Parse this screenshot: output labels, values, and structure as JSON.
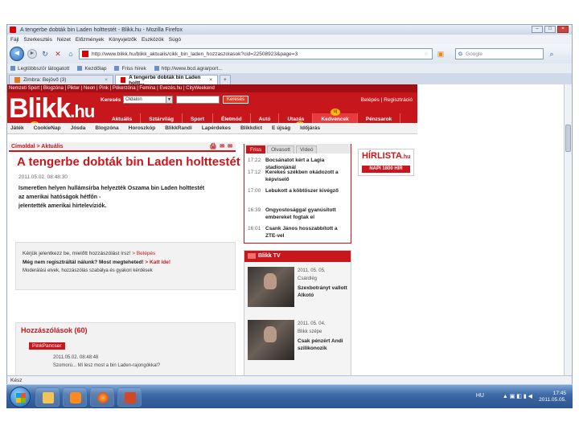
{
  "browser": {
    "title": "A tengerbe dobták bin Laden holttestét - Blikk.hu - Mozilla Firefox",
    "window_buttons": [
      "–",
      "□",
      "×"
    ],
    "menu": [
      "Fájl",
      "Szerkesztés",
      "Nézet",
      "Előzmények",
      "Könyvjelzők",
      "Eszközök",
      "Súgó"
    ],
    "url": "http://www.blikk.hu/blikk_aktualis/cikk_bin_laden_hozzaszolasok?cid=22508923&page=3",
    "search_placeholder": "Google",
    "search_logo": "G",
    "bookmarks": [
      "Legtöbbször látogatott",
      "Kezdőlap",
      "Friss hírek",
      "http://www.bcd.agrarport..."
    ],
    "tabs": [
      {
        "label": "Zimbra: Bejövő (3)",
        "active": false
      },
      {
        "label": "A tengerbe dobták bin Laden holtt...",
        "active": true
      }
    ],
    "tab_close": "×",
    "status": "Kész"
  },
  "site": {
    "topnav": "Nemzeti Sport | Blogzóna | Pikter | Neon | Pink | Pókerzóna | Femina | Evezés.hu | CityWeekend",
    "logo_main": "Blikk",
    "logo_tld": ".hu",
    "search_label": "Keresés",
    "search_select": "Oldalon",
    "search_select_caret": "▼",
    "search_button": "Keresés",
    "login": "Belépés | Regisztráció",
    "mainnav": [
      "Aktuális",
      "Sztárvilág",
      "Sport",
      "Életmód",
      "Autó",
      "Utazás",
      "Kedvencek",
      "Pénzsarok"
    ],
    "uj_badge": "új",
    "subnav": [
      "Játék",
      "CookieNap",
      "Jósda",
      "Blogzóna",
      "Horoszkóp",
      "BlikkRandi",
      "Lapérdekes",
      "Blikkdict",
      "E újság",
      "Időjárás"
    ],
    "breadcrumb": "Címoldal > Aktuális",
    "article_icons": [
      "🖨",
      "✉",
      "✉"
    ],
    "headline": "A tengerbe dobták bin Laden holttestét",
    "date": "2011.05.02. 08:48:30",
    "lead_lines": [
      "Ismeretlen helyen hullámsírba helyezték Oszama bin Laden holttestét",
      "az amerikai hatóságok hétfőn -",
      "jelentették amerikai hírtelevíziók."
    ],
    "loginbox": {
      "line1_text": "Kérjük jelentkezz be, mielőtt hozzászólást írsz!",
      "line1_link": "Belépés",
      "line2_text": "Még nem regisztráltál nálunk? Most megteheted!",
      "line2_link": "Katt ide!",
      "line3": "Moderálási elvek, hozzászólás szabálya és gyakori kérdések"
    },
    "comments": {
      "title": "Hozzászólások (60)",
      "user": "PinkPancser",
      "meta": "2011.05.02. 08:48:48",
      "snippet": "Szomorú... Mi lesz most a bin Laden-rajongókkal?"
    },
    "news_tabs": [
      "Friss",
      "Olvasott",
      "Videó"
    ],
    "news": [
      {
        "time": "17:22",
        "title": "Bocsánatot kért a Lagia stadionjánál"
      },
      {
        "time": "17:12",
        "title": "Kerekes székben okádozott a képviselő"
      },
      {
        "time": "17:00",
        "title": "Lebukott a köbtöszer kivégző"
      },
      {
        "time": "16:39",
        "title": "Ongyostosággal gyanúsított embereket fogtak el"
      },
      {
        "time": "16:01",
        "title": "Csank János hosszabbított a ZTE-vel"
      }
    ],
    "tv_title": "Blikk TV",
    "tv_items": [
      {
        "date": "2011. 05. 05.",
        "source": "Csárdlég",
        "title": "Szexbotrányt vallott Alkotó"
      },
      {
        "date": "2011. 05. 04.",
        "source": "Blikk szépe",
        "title": "Csak pénzért Andi szilikonozik"
      }
    ],
    "ad": {
      "logo": "HÍRLISTA",
      "logo_tld": ".hu",
      "tagline": "NAPI 1800 HÍR"
    }
  },
  "taskbar": {
    "clock_time": "17:45",
    "clock_date": "2011.05.05.",
    "tray_lang": "HU",
    "tray_icons": "▲ ▣ ◧ ▮ ◀"
  }
}
